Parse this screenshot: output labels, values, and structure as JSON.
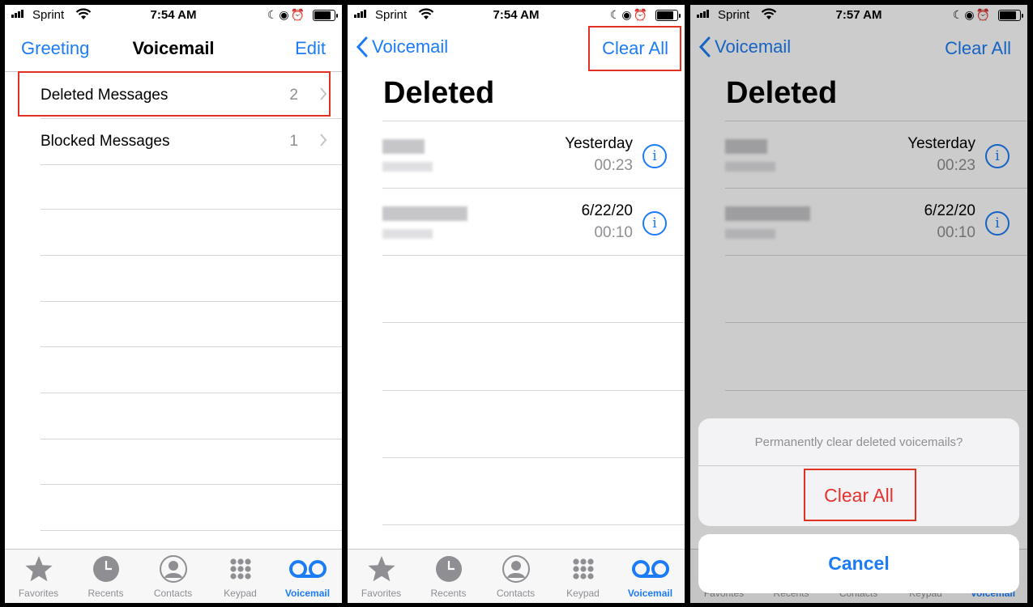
{
  "colors": {
    "accent": "#1b7cf5",
    "destructive": "#e5322d",
    "highlight": "#e03121",
    "secondary_text": "#8e8e93"
  },
  "status": {
    "carrier": "Sprint"
  },
  "panel1": {
    "time": "7:54 AM",
    "nav": {
      "left": "Greeting",
      "title": "Voicemail",
      "right": "Edit"
    },
    "rows": [
      {
        "label": "Deleted Messages",
        "count": "2"
      },
      {
        "label": "Blocked Messages",
        "count": "1"
      }
    ]
  },
  "panel2": {
    "time": "7:54 AM",
    "nav": {
      "back": "Voicemail",
      "right": "Clear All"
    },
    "title": "Deleted",
    "voicemails": [
      {
        "date": "Yesterday",
        "duration": "00:23"
      },
      {
        "date": "6/22/20",
        "duration": "00:10"
      }
    ]
  },
  "panel3": {
    "time": "7:57 AM",
    "nav": {
      "back": "Voicemail",
      "right": "Clear All"
    },
    "title": "Deleted",
    "voicemails": [
      {
        "date": "Yesterday",
        "duration": "00:23"
      },
      {
        "date": "6/22/20",
        "duration": "00:10"
      }
    ],
    "action_sheet": {
      "message": "Permanently clear deleted voicemails?",
      "destructive": "Clear All",
      "cancel": "Cancel"
    }
  },
  "tabs": [
    {
      "label": "Favorites",
      "icon": "star-icon"
    },
    {
      "label": "Recents",
      "icon": "clock-icon"
    },
    {
      "label": "Contacts",
      "icon": "person-icon"
    },
    {
      "label": "Keypad",
      "icon": "keypad-icon"
    },
    {
      "label": "Voicemail",
      "icon": "voicemail-icon",
      "active": true
    }
  ]
}
